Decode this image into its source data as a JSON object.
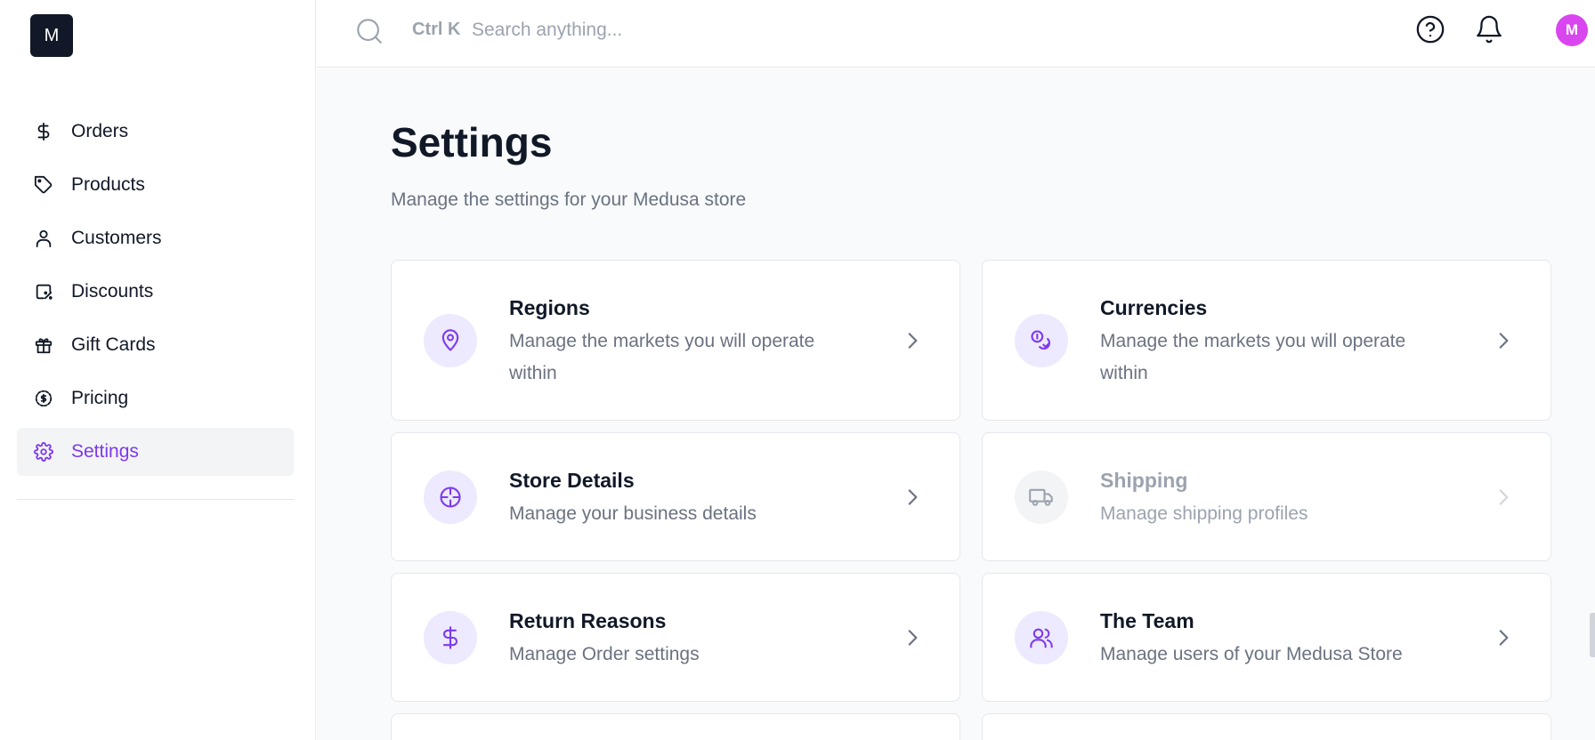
{
  "logo": {
    "letter": "M"
  },
  "sidebar": {
    "items": [
      {
        "label": "Orders",
        "icon": "dollar-icon"
      },
      {
        "label": "Products",
        "icon": "tag-icon"
      },
      {
        "label": "Customers",
        "icon": "user-icon"
      },
      {
        "label": "Discounts",
        "icon": "discount-icon"
      },
      {
        "label": "Gift Cards",
        "icon": "gift-icon"
      },
      {
        "label": "Pricing",
        "icon": "pricing-icon"
      },
      {
        "label": "Settings",
        "icon": "gear-icon",
        "active": true
      }
    ]
  },
  "topbar": {
    "shortcut": "Ctrl K",
    "search_placeholder": "Search anything...",
    "avatar_initial": "M"
  },
  "main": {
    "title": "Settings",
    "subtitle": "Manage the settings for your Medusa store",
    "cards": [
      {
        "title": "Regions",
        "description": "Manage the markets you will operate within",
        "icon": "map-pin-icon"
      },
      {
        "title": "Currencies",
        "description": "Manage the markets you will operate within",
        "icon": "coins-icon"
      },
      {
        "title": "Store Details",
        "description": "Manage your business details",
        "icon": "crosshair-icon"
      },
      {
        "title": "Shipping",
        "description": "Manage shipping profiles",
        "icon": "truck-icon",
        "disabled": true
      },
      {
        "title": "Return Reasons",
        "description": "Manage Order settings",
        "icon": "dollar-icon"
      },
      {
        "title": "The Team",
        "description": "Manage users of your Medusa Store",
        "icon": "users-icon"
      }
    ]
  },
  "colors": {
    "accent": "#7c3aed",
    "accent_bg": "#ede9fe",
    "avatar": "#d946ef",
    "logo_bg": "#111827"
  }
}
